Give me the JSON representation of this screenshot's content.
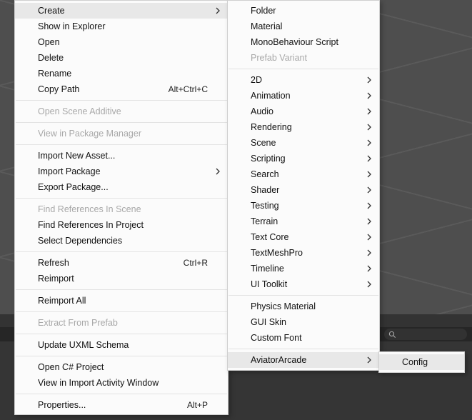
{
  "menu1": {
    "items": [
      {
        "label": "Create",
        "submenu": true,
        "highlight": true
      },
      {
        "label": "Show in Explorer"
      },
      {
        "label": "Open"
      },
      {
        "label": "Delete"
      },
      {
        "label": "Rename"
      },
      {
        "label": "Copy Path",
        "accel": "Alt+Ctrl+C"
      },
      {
        "sep": true
      },
      {
        "label": "Open Scene Additive",
        "disabled": true
      },
      {
        "sep": true
      },
      {
        "label": "View in Package Manager",
        "disabled": true
      },
      {
        "sep": true
      },
      {
        "label": "Import New Asset..."
      },
      {
        "label": "Import Package",
        "submenu": true
      },
      {
        "label": "Export Package..."
      },
      {
        "sep": true
      },
      {
        "label": "Find References In Scene",
        "disabled": true
      },
      {
        "label": "Find References In Project"
      },
      {
        "label": "Select Dependencies"
      },
      {
        "sep": true
      },
      {
        "label": "Refresh",
        "accel": "Ctrl+R"
      },
      {
        "label": "Reimport"
      },
      {
        "sep": true
      },
      {
        "label": "Reimport All"
      },
      {
        "sep": true
      },
      {
        "label": "Extract From Prefab",
        "disabled": true
      },
      {
        "sep": true
      },
      {
        "label": "Update UXML Schema"
      },
      {
        "sep": true
      },
      {
        "label": "Open C# Project"
      },
      {
        "label": "View in Import Activity Window"
      },
      {
        "sep": true
      },
      {
        "label": "Properties...",
        "accel": "Alt+P"
      }
    ]
  },
  "menu2": {
    "items": [
      {
        "label": "Folder"
      },
      {
        "label": "Material"
      },
      {
        "label": "MonoBehaviour Script"
      },
      {
        "label": "Prefab Variant",
        "disabled": true
      },
      {
        "sep": true
      },
      {
        "label": "2D",
        "submenu": true
      },
      {
        "label": "Animation",
        "submenu": true
      },
      {
        "label": "Audio",
        "submenu": true
      },
      {
        "label": "Rendering",
        "submenu": true
      },
      {
        "label": "Scene",
        "submenu": true
      },
      {
        "label": "Scripting",
        "submenu": true
      },
      {
        "label": "Search",
        "submenu": true
      },
      {
        "label": "Shader",
        "submenu": true
      },
      {
        "label": "Testing",
        "submenu": true
      },
      {
        "label": "Terrain",
        "submenu": true
      },
      {
        "label": "Text Core",
        "submenu": true
      },
      {
        "label": "TextMeshPro",
        "submenu": true
      },
      {
        "label": "Timeline",
        "submenu": true
      },
      {
        "label": "UI Toolkit",
        "submenu": true
      },
      {
        "sep": true
      },
      {
        "label": "Physics Material"
      },
      {
        "label": "GUI Skin"
      },
      {
        "label": "Custom Font"
      },
      {
        "sep": true
      },
      {
        "label": "AviatorArcade",
        "submenu": true,
        "highlight": true
      }
    ]
  },
  "menu3": {
    "items": [
      {
        "label": "Config",
        "highlight": true
      }
    ]
  }
}
